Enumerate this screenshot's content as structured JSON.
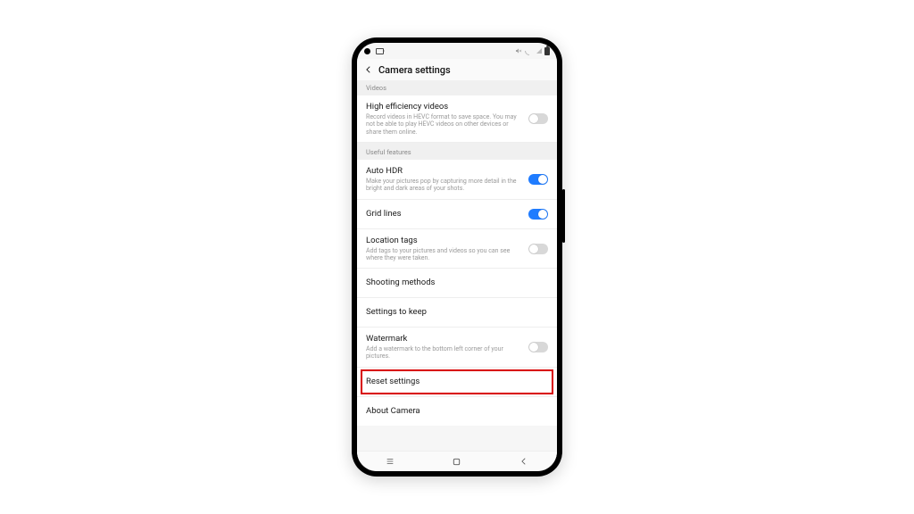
{
  "header": {
    "title": "Camera settings"
  },
  "sections": {
    "videos_label": "Videos",
    "useful_label": "Useful features"
  },
  "rows": {
    "hev": {
      "title": "High efficiency videos",
      "desc": "Record videos in HEVC format to save space. You may not be able to play HEVC videos on other devices or share them online."
    },
    "autohdr": {
      "title": "Auto HDR",
      "desc": "Make your pictures pop by capturing more detail in the bright and dark areas of your shots."
    },
    "grid": {
      "title": "Grid lines"
    },
    "location": {
      "title": "Location tags",
      "desc": "Add tags to your pictures and videos so you can see where they were taken."
    },
    "shooting": {
      "title": "Shooting methods"
    },
    "keep": {
      "title": "Settings to keep"
    },
    "watermark": {
      "title": "Watermark",
      "desc": "Add a watermark to the bottom left corner of your pictures."
    },
    "reset": {
      "title": "Reset settings"
    },
    "about": {
      "title": "About Camera"
    }
  }
}
